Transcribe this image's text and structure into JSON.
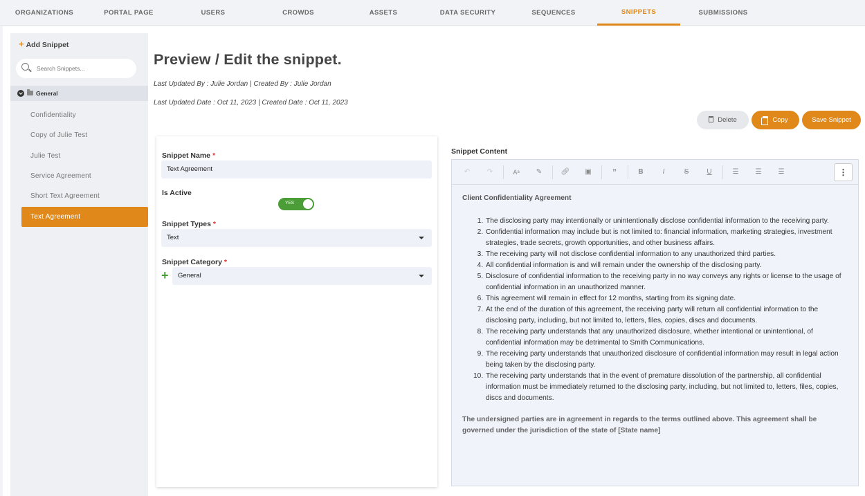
{
  "nav": {
    "tabs": [
      {
        "label": "ORGANIZATIONS"
      },
      {
        "label": "PORTAL PAGE"
      },
      {
        "label": "USERS"
      },
      {
        "label": "CROWDS"
      },
      {
        "label": "ASSETS"
      },
      {
        "label": "DATA SECURITY"
      },
      {
        "label": "SEQUENCES"
      },
      {
        "label": "SNIPPETS"
      },
      {
        "label": "SUBMISSIONS"
      }
    ],
    "active": "SNIPPETS"
  },
  "sidebar": {
    "add_label": "Add Snippet",
    "search_placeholder": "Search Snippets...",
    "folder": "General",
    "items": [
      {
        "label": "Confidentiality"
      },
      {
        "label": "Copy of Julie Test"
      },
      {
        "label": "Julie Test"
      },
      {
        "label": "Service Agreement"
      },
      {
        "label": "Short Text Agreement"
      },
      {
        "label": "Text Agreement"
      }
    ],
    "selected": "Text Agreement"
  },
  "header": {
    "title": "Preview / Edit the snippet.",
    "updated_by": "Last Updated By : Julie Jordan  |  Created By : Julie Jordan",
    "updated_date": "Last Updated Date : Oct 11, 2023  |  Created Date : Oct 11, 2023"
  },
  "actions": {
    "delete": "Delete",
    "copy": "Copy",
    "save": "Save Snippet"
  },
  "form": {
    "name_label": "Snippet Name",
    "name_value": "Text Agreement",
    "active_label": "Is Active",
    "active_toggle": "YES",
    "types_label": "Snippet Types",
    "types_value": "Text",
    "category_label": "Snippet Category",
    "category_value": "General",
    "required_mark": "*"
  },
  "editor": {
    "label": "Snippet Content",
    "heading": "Client Confidentiality Agreement",
    "items": [
      "The disclosing party may intentionally or unintentionally disclose confidential information to the receiving party.",
      "Confidential information may include but is not limited to: financial information, marketing strategies, investment strategies, trade secrets, growth opportunities, and other business affairs.",
      "The receiving party will not disclose confidential information to any unauthorized third parties.",
      "All confidential information is and will remain under the ownership of the disclosing party.",
      "Disclosure of confidential information to the receiving party in no way conveys any rights or license to the usage of confidential information in an unauthorized manner.",
      "This agreement will remain in effect for 12 months, starting from its signing date.",
      "At the end of the duration of this agreement, the receiving party will return all confidential information to the disclosing party, including, but not limited to, letters, files, copies, discs and documents.",
      "The receiving party understands that any unauthorized disclosure, whether intentional or unintentional, of confidential information may be detrimental to Smith Communications.",
      "The receiving party understands that unauthorized disclosure of confidential information may result in legal action being taken by the disclosing party.",
      "The receiving party understands that in the event of premature dissolution of the partnership, all confidential information must be immediately returned to the disclosing party, including, but not limited to, letters, files, copies, discs and documents."
    ],
    "closing": "The undersigned parties are in agreement in regards to the terms outlined above. This agreement shall be governed under the jurisdiction of the state of [State name]",
    "toolbar": [
      "undo-icon",
      "redo-icon",
      "font-size-icon",
      "highlight-pen-icon",
      "link-icon",
      "image-icon",
      "quote-icon",
      "bold-icon",
      "italic-icon",
      "strikethrough-icon",
      "underline-icon",
      "align-left-icon",
      "align-center-icon",
      "align-right-icon",
      "more-options-icon"
    ]
  },
  "colors": {
    "accent": "#e0891a",
    "toggle_on": "#4a9d37"
  }
}
